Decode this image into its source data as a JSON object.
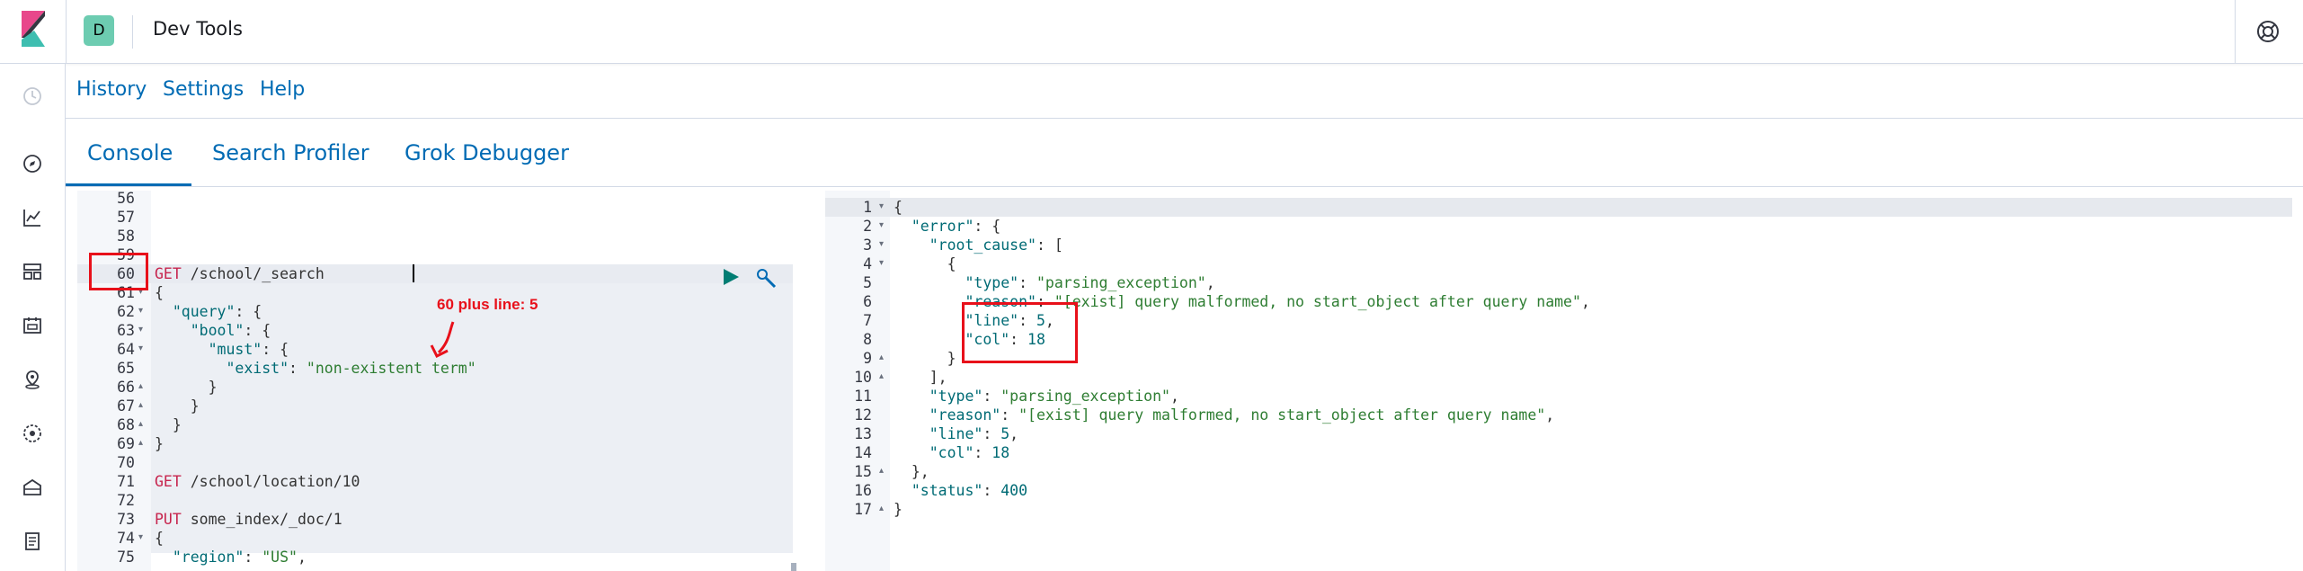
{
  "header": {
    "space_initial": "D",
    "app_title": "Dev Tools"
  },
  "nav_icons": [
    "clock-icon",
    "compass-icon",
    "chart-icon",
    "dashboard-icon",
    "canvas-icon",
    "maps-icon",
    "ml-icon",
    "infrastructure-icon",
    "logs-icon"
  ],
  "top_menu": {
    "history": "History",
    "settings": "Settings",
    "help": "Help"
  },
  "tabs": {
    "console": "Console",
    "search_profiler": "Search Profiler",
    "grok_debugger": "Grok Debugger"
  },
  "request_editor": {
    "lines": [
      {
        "n": "56",
        "parts": []
      },
      {
        "n": "57",
        "parts": []
      },
      {
        "n": "58",
        "parts": []
      },
      {
        "n": "59",
        "parts": []
      },
      {
        "n": "60",
        "parts": [
          {
            "t": "GET",
            "c": "kw-get"
          },
          {
            "t": " /school/_search",
            "c": "path"
          }
        ]
      },
      {
        "n": "61",
        "fold": "▾",
        "parts": [
          {
            "t": "{",
            "c": "punc"
          }
        ]
      },
      {
        "n": "62",
        "fold": "▾",
        "parts": [
          {
            "t": "  \"query\"",
            "c": "key"
          },
          {
            "t": ": {",
            "c": "punc"
          }
        ]
      },
      {
        "n": "63",
        "fold": "▾",
        "parts": [
          {
            "t": "    \"bool\"",
            "c": "key"
          },
          {
            "t": ": {",
            "c": "punc"
          }
        ]
      },
      {
        "n": "64",
        "fold": "▾",
        "parts": [
          {
            "t": "      \"must\"",
            "c": "key"
          },
          {
            "t": ": {",
            "c": "punc"
          }
        ]
      },
      {
        "n": "65",
        "parts": [
          {
            "t": "        \"exist\"",
            "c": "key"
          },
          {
            "t": ": ",
            "c": "punc"
          },
          {
            "t": "\"non-existent term\"",
            "c": "str"
          }
        ]
      },
      {
        "n": "66",
        "fold": "▴",
        "parts": [
          {
            "t": "      }",
            "c": "punc"
          }
        ]
      },
      {
        "n": "67",
        "fold": "▴",
        "parts": [
          {
            "t": "    }",
            "c": "punc"
          }
        ]
      },
      {
        "n": "68",
        "fold": "▴",
        "parts": [
          {
            "t": "  }",
            "c": "punc"
          }
        ]
      },
      {
        "n": "69",
        "fold": "▴",
        "parts": [
          {
            "t": "}",
            "c": "punc"
          }
        ]
      },
      {
        "n": "70",
        "parts": []
      },
      {
        "n": "71",
        "parts": [
          {
            "t": "GET",
            "c": "kw-get"
          },
          {
            "t": " /school/location/10",
            "c": "path"
          }
        ]
      },
      {
        "n": "72",
        "parts": []
      },
      {
        "n": "73",
        "parts": [
          {
            "t": "PUT",
            "c": "kw-get"
          },
          {
            "t": " some_index/_doc/1",
            "c": "path"
          }
        ]
      },
      {
        "n": "74",
        "fold": "▾",
        "parts": [
          {
            "t": "{",
            "c": "punc"
          }
        ]
      },
      {
        "n": "75",
        "parts": [
          {
            "t": "  \"region\"",
            "c": "key"
          },
          {
            "t": ": ",
            "c": "punc"
          },
          {
            "t": "\"US\"",
            "c": "str"
          },
          {
            "t": ",",
            "c": "punc"
          }
        ]
      }
    ]
  },
  "response_editor": {
    "lines": [
      {
        "n": "1",
        "fold": "▾",
        "parts": [
          {
            "t": "{",
            "c": "punc"
          }
        ]
      },
      {
        "n": "2",
        "fold": "▾",
        "parts": [
          {
            "t": "  \"error\"",
            "c": "key"
          },
          {
            "t": ": {",
            "c": "punc"
          }
        ]
      },
      {
        "n": "3",
        "fold": "▾",
        "parts": [
          {
            "t": "    \"root_cause\"",
            "c": "key"
          },
          {
            "t": ": [",
            "c": "punc"
          }
        ]
      },
      {
        "n": "4",
        "fold": "▾",
        "parts": [
          {
            "t": "      {",
            "c": "punc"
          }
        ]
      },
      {
        "n": "5",
        "parts": [
          {
            "t": "        \"type\"",
            "c": "key"
          },
          {
            "t": ": ",
            "c": "punc"
          },
          {
            "t": "\"parsing_exception\"",
            "c": "str"
          },
          {
            "t": ",",
            "c": "punc"
          }
        ]
      },
      {
        "n": "6",
        "parts": [
          {
            "t": "        \"reason\"",
            "c": "key"
          },
          {
            "t": ": ",
            "c": "punc"
          },
          {
            "t": "\"[exist] query malformed, no start_object after query name\"",
            "c": "str"
          },
          {
            "t": ",",
            "c": "punc"
          }
        ]
      },
      {
        "n": "7",
        "parts": [
          {
            "t": "        \"line\"",
            "c": "key"
          },
          {
            "t": ": ",
            "c": "punc"
          },
          {
            "t": "5",
            "c": "num"
          },
          {
            "t": ",",
            "c": "punc"
          }
        ]
      },
      {
        "n": "8",
        "parts": [
          {
            "t": "        \"col\"",
            "c": "key"
          },
          {
            "t": ": ",
            "c": "punc"
          },
          {
            "t": "18",
            "c": "num"
          }
        ]
      },
      {
        "n": "9",
        "fold": "▴",
        "parts": [
          {
            "t": "      }",
            "c": "punc"
          }
        ]
      },
      {
        "n": "10",
        "fold": "▴",
        "parts": [
          {
            "t": "    ],",
            "c": "punc"
          }
        ]
      },
      {
        "n": "11",
        "parts": [
          {
            "t": "    \"type\"",
            "c": "key"
          },
          {
            "t": ": ",
            "c": "punc"
          },
          {
            "t": "\"parsing_exception\"",
            "c": "str"
          },
          {
            "t": ",",
            "c": "punc"
          }
        ]
      },
      {
        "n": "12",
        "parts": [
          {
            "t": "    \"reason\"",
            "c": "key"
          },
          {
            "t": ": ",
            "c": "punc"
          },
          {
            "t": "\"[exist] query malformed, no start_object after query name\"",
            "c": "str"
          },
          {
            "t": ",",
            "c": "punc"
          }
        ]
      },
      {
        "n": "13",
        "parts": [
          {
            "t": "    \"line\"",
            "c": "key"
          },
          {
            "t": ": ",
            "c": "punc"
          },
          {
            "t": "5",
            "c": "num"
          },
          {
            "t": ",",
            "c": "punc"
          }
        ]
      },
      {
        "n": "14",
        "parts": [
          {
            "t": "    \"col\"",
            "c": "key"
          },
          {
            "t": ": ",
            "c": "punc"
          },
          {
            "t": "18",
            "c": "num"
          }
        ]
      },
      {
        "n": "15",
        "fold": "▴",
        "parts": [
          {
            "t": "  },",
            "c": "punc"
          }
        ]
      },
      {
        "n": "16",
        "parts": [
          {
            "t": "  \"status\"",
            "c": "key"
          },
          {
            "t": ": ",
            "c": "punc"
          },
          {
            "t": "400",
            "c": "num"
          }
        ]
      },
      {
        "n": "17",
        "fold": "▴",
        "parts": [
          {
            "t": "}",
            "c": "punc"
          }
        ]
      }
    ]
  },
  "annotation": {
    "note": "60 plus line: 5",
    "color": "#e8101a"
  },
  "colors": {
    "link": "#006bb4",
    "space_avatar": "#6dccb1"
  }
}
